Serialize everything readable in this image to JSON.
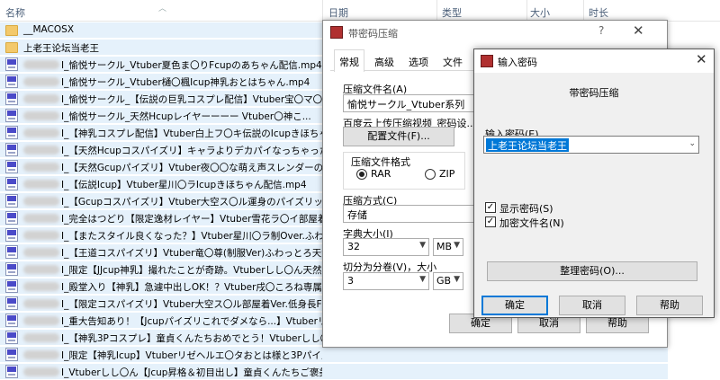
{
  "explorer": {
    "columns": {
      "name": "名称",
      "date": "日期",
      "type": "类型",
      "size": "大小",
      "duration": "时长"
    },
    "rows": [
      {
        "icon": "folder",
        "name": "__MACOSX",
        "blurred": false
      },
      {
        "icon": "folder",
        "name": "上老王论坛当老王",
        "blurred": false
      },
      {
        "icon": "mp4",
        "name": "I_愉悦サークル_Vtuber夏色ま〇りFcupのあちゃん配信.mp4",
        "blurred": true
      },
      {
        "icon": "mp4",
        "name": "I_愉悦サークル_Vtuber樋〇楓Icup神乳おとはちゃん.mp4",
        "blurred": true
      },
      {
        "icon": "mp4",
        "name": "I_愉悦サークル_【伝説の巨乳コスプレ配信】Vtuber宝〇マ〇ン...",
        "blurred": true
      },
      {
        "icon": "mp4",
        "name": "I_愉悦サークル_天然Hcupレイヤーーーー Vtuber〇神こ...",
        "blurred": true
      },
      {
        "icon": "mp4",
        "name": "I_【神乳コスプレ配信】Vtuber白上フ〇キ伝説のIcupきほちゃ...",
        "blurred": true
      },
      {
        "icon": "mp4",
        "name": "I_【天然Hcupコスパイズリ】キャラよりデカパイなっちゃった...",
        "blurred": true
      },
      {
        "icon": "mp4",
        "name": "I_【天然Gcupパイズリ】Vtuber夜〇〇な萌え声スレンダーの天...",
        "blurred": true
      },
      {
        "icon": "mp4",
        "name": "I_【伝説Icup】Vtuber星川〇ラIcupきほちゃん配信.mp4",
        "blurred": true
      },
      {
        "icon": "mp4",
        "name": "I_【Gcupコスパイズリ】Vtuber大空ス〇ル運身のパイズリッ...",
        "blurred": true
      },
      {
        "icon": "mp4",
        "name": "I_完全はつどり【限定逸材レイヤー】Vtuber雪花ラ〇イ部屋着V...",
        "blurred": true
      },
      {
        "icon": "mp4",
        "name": "I_【またスタイル良くなった？】Vtuber星川〇ラ制Over.ふわっ...",
        "blurred": true
      },
      {
        "icon": "mp4",
        "name": "I_【王道コスパイズリ】Vtuber竜〇尊(制服Ver)ふわっとろ天然...",
        "blurred": true
      },
      {
        "icon": "mp4",
        "name": "I_限定【JJcup神乳】撮れたことが奇跡。Vtuberしし〇ん天然I...",
        "blurred": true
      },
      {
        "icon": "mp4",
        "name": "I_殿堂入り【神乳】急遽中出しOK！？Vtuber戌〇ころね専属Icup...",
        "blurred": true
      },
      {
        "icon": "mp4",
        "name": "I_【限定コスパイズリ】Vtuber大空ス〇ル部屋着Ver.低身長Fcu...",
        "blurred": true
      },
      {
        "icon": "mp4",
        "name": "I_重大告知あり！【Jcupパイズリこれでダメなら...】Vtuberリ...",
        "blurred": true
      },
      {
        "icon": "mp4",
        "name": "I_【神乳3Pコスプレ】童貞くんたちおめでとう！Vtuberしし〇...",
        "blurred": true
      },
      {
        "icon": "mp4",
        "name": "I_限定【神乳Icup】Vtuberリゼヘルエ〇タおとは様と3Pパイズ...",
        "blurred": true
      },
      {
        "icon": "mp4",
        "name": "I_Vtuberしし〇ん【Jcup昇格＆初目出し】童貞くんたちご褒美...",
        "blurred": true
      }
    ]
  },
  "dialog1": {
    "title": "带密码压缩",
    "help_glyph": "?",
    "close_glyph": "✕",
    "tabs": [
      "常规",
      "高级",
      "选项",
      "文件"
    ],
    "archive_name_label": "压缩文件名(A)",
    "archive_name_value": "愉悦サークル_Vtuber系列",
    "profile_label": "百度云上传压缩视频_密码设...",
    "profile_button": "配置文件(F)...",
    "format_label": "压缩文件格式",
    "format_rar": "RAR",
    "format_zip": "ZIP",
    "method_label": "压缩方式(C)",
    "method_value": "存储",
    "dict_label": "字典大小(I)",
    "dict_value": "32",
    "dict_unit": "MB",
    "split_label": "切分为分卷(V)，大小",
    "split_value": "3",
    "split_unit": "GB",
    "ok_button": "确定",
    "cancel_button": "取消",
    "help_button": "帮助"
  },
  "dialog2": {
    "title": "输入密码",
    "close_glyph": "✕",
    "heading": "带密码压缩",
    "password_label": "输入密码(E)",
    "password_value": "上老王论坛当老王",
    "show_password_label": "显示密码(S)",
    "show_password_checked": true,
    "encrypt_names_label": "加密文件名(N)",
    "encrypt_names_checked": true,
    "organize_button": "整理密码(O)...",
    "ok_button": "确定",
    "cancel_button": "取消",
    "help_button": "帮助"
  }
}
